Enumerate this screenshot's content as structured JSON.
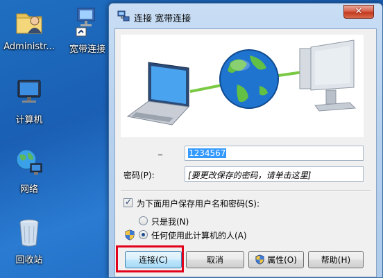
{
  "desktop": {
    "icons": [
      {
        "label": "Administr..."
      },
      {
        "label": "宽带连接"
      },
      {
        "label": "计算机"
      },
      {
        "label": "网络"
      },
      {
        "label": "回收站"
      }
    ]
  },
  "dialog": {
    "title": "连接 宽带连接",
    "close_label": "✕",
    "username_label": "_",
    "username_value": "1234567",
    "password_label": "密码(P):",
    "password_hint": "[要更改保存的密码，请单击这里]",
    "save_checkbox_label": "为下面用户保存用户名和密码(S):",
    "save_checked": true,
    "radio_me_label": "只是我(N)",
    "radio_anyone_label": "任何使用此计算机的人(A)",
    "selected_radio": "anyone",
    "buttons": {
      "connect": "连接(C)",
      "cancel": "取消",
      "properties": "属性(O)",
      "help": "帮助(H)"
    }
  },
  "colors": {
    "highlight_border": "#e2001a",
    "selection": "#3399ff",
    "desktop": "#1a5fb4"
  }
}
